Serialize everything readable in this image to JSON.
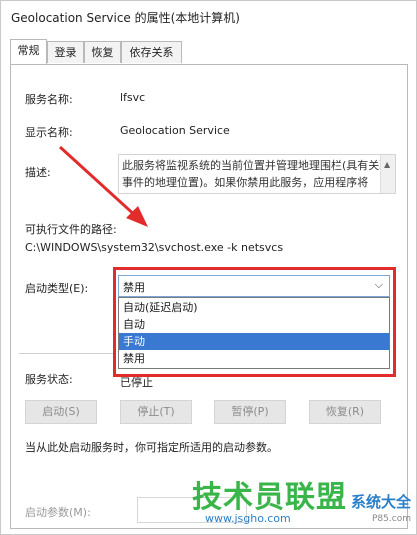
{
  "window": {
    "title": "Geolocation Service 的属性(本地计算机)"
  },
  "tabs": [
    {
      "label": "常规",
      "active": true
    },
    {
      "label": "登录",
      "active": false
    },
    {
      "label": "恢复",
      "active": false
    },
    {
      "label": "依存关系",
      "active": false
    }
  ],
  "general": {
    "service_name_label": "服务名称:",
    "service_name_value": "lfsvc",
    "display_name_label": "显示名称:",
    "display_name_value": "Geolocation Service",
    "description_label": "描述:",
    "description_value": "此服务将监视系统的当前位置并管理地理围栏(具有关联事件的地理位置)。如果你禁用此服务，应用程序将",
    "exe_path_label": "可执行文件的路径:",
    "exe_path_value": "C:\\WINDOWS\\system32\\svchost.exe -k netsvcs",
    "startup_type_label": "启动类型(E):",
    "startup_type_value": "禁用",
    "startup_options": [
      "自动(延迟启动)",
      "自动",
      "手动",
      "禁用"
    ],
    "startup_options_selected": "手动",
    "service_status_label": "服务状态:",
    "service_status_value": "已停止",
    "buttons": {
      "start": "启动(S)",
      "stop": "停止(T)",
      "pause": "暂停(P)",
      "resume": "恢复(R)"
    },
    "hint": "当从此处启动服务时，你可指定所适用的启动参数。",
    "start_params_label": "启动参数(M):",
    "start_params_value": ""
  },
  "watermark": {
    "brand": "技术员联盟",
    "brand_tail": "系统大全",
    "url": "www.jsgho.com",
    "url2": "P85.com"
  },
  "colors": {
    "highlight_box": "#e22b2b",
    "selection": "#3a79d1",
    "watermark_green": "#39b54a"
  }
}
